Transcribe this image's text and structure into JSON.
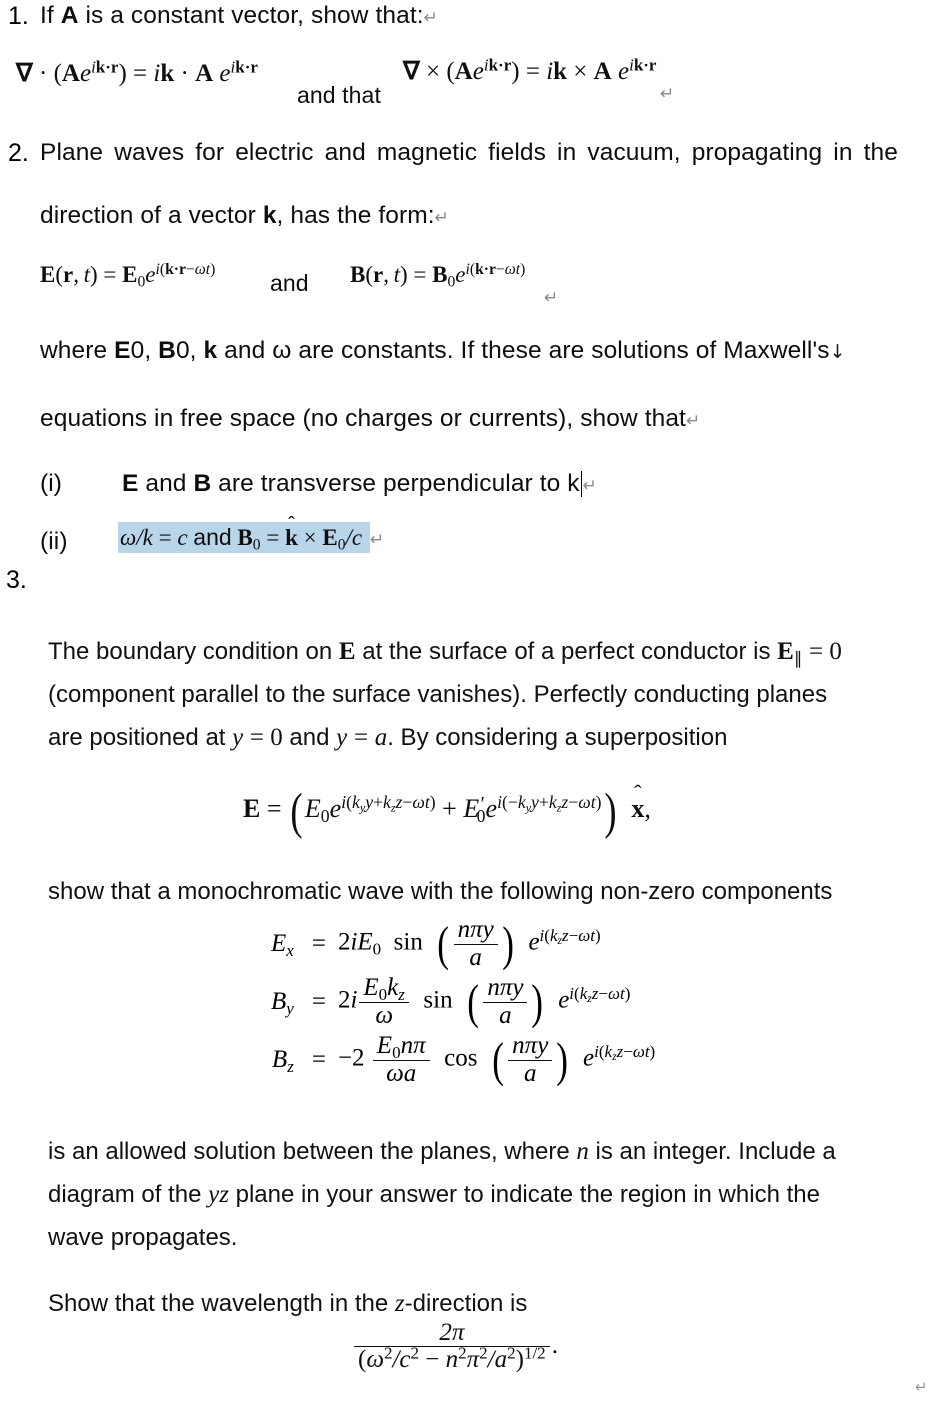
{
  "document": {
    "type": "physics-problem-sheet",
    "highlight_color": "#b9d5ea",
    "text_color": "#0d0d0d",
    "background": "#ffffff"
  },
  "items": [
    {
      "number": "1.",
      "prompt": "If A is a constant vector, show that:",
      "prompt_parts": {
        "before": "If ",
        "bold": "A",
        "after": " is a constant vector, show that:"
      },
      "equation_left": "∇ · (Ae^{ik·r}) = ik · A e^{ik·r}",
      "connector": "and that",
      "equation_right": "∇ × (Ae^{ik·r}) = ik × A e^{ik·r}"
    },
    {
      "number": "2.",
      "line1": "Plane waves for electric and magnetic fields in vacuum, propagating in the",
      "line2_before": "direction of a vector ",
      "line2_bold": "k",
      "line2_after": ", has the form:",
      "equation_E": "E(r, t) = E₀e^{i(k·r−ωt)}",
      "equation_connector": "and",
      "equation_B": "B(r, t) = B₀e^{i(k·r−ωt)}",
      "line3": "where E0, B0, k and ω are constants. If these are solutions of Maxwell's",
      "line4": "equations in free space (no charges or currents), show that",
      "subitems": [
        {
          "label": "(i)",
          "text": "E and B are transverse perpendicular to k",
          "highlighted": false
        },
        {
          "label": "(ii)",
          "text": "ω/k = c and B₀ = k̂ × E₀/c",
          "highlighted": true
        }
      ]
    },
    {
      "number": "3.",
      "paragraph1_line1": "The boundary condition on E at the surface of a perfect conductor is E∥ = 0",
      "paragraph1_line2": "(component parallel to the surface vanishes). Perfectly conducting planes",
      "paragraph1_line3": "are positioned at y = 0 and y = a. By considering a superposition",
      "superposition_equation": "E = (E₀e^{i(k_y y + k_z z − ωt)} + E₀′e^{i(−k_y y + k_z z − ωt)}) x̂,",
      "paragraph2": "show that a monochromatic wave with the following non-zero components",
      "components": [
        {
          "lhs": "E_x",
          "rel": "=",
          "coefficient": "2iE₀",
          "trig": "sin",
          "argument_num": "nπy",
          "argument_den": "a",
          "exponential": "e^{i(k_z z − ωt)}"
        },
        {
          "lhs": "B_y",
          "rel": "=",
          "coefficient_prefix": "2i",
          "coefficient_num": "E₀k_z",
          "coefficient_den": "ω",
          "trig": "sin",
          "argument_num": "nπy",
          "argument_den": "a",
          "exponential": "e^{i(k_z z − ωt)}"
        },
        {
          "lhs": "B_z",
          "rel": "=",
          "coefficient_prefix": "−2",
          "coefficient_num": "E₀nπ",
          "coefficient_den": "ωa",
          "trig": "cos",
          "argument_num": "nπy",
          "argument_den": "a",
          "exponential": "e^{i(k_z z − ωt)}"
        }
      ],
      "paragraph3_line1": "is an allowed solution between the planes, where n is an integer. Include a",
      "paragraph3_line2": "diagram of the yz plane in your answer to indicate the region in which the",
      "paragraph3_line3": "wave propagates.",
      "paragraph4": "Show that the wavelength in the z-direction is",
      "final_fraction": {
        "numerator": "2π",
        "denominator": "(ω²/c² − n²π²/a²)^{1/2}",
        "trailing": "."
      }
    }
  ],
  "marks": {
    "paragraph_return": "↵",
    "soft_return": "↓",
    "caret": "|"
  }
}
